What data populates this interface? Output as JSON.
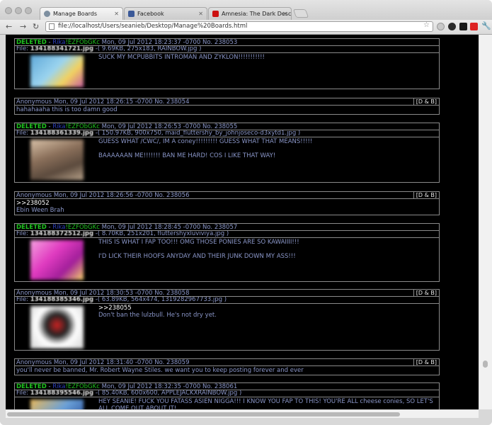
{
  "browser": {
    "tabs": [
      {
        "title": "Manage Boards",
        "favicon_color": "#7d8fa0"
      },
      {
        "title": "Facebook",
        "favicon_color": "#3b5998"
      },
      {
        "title": "Amnesia: The Dark Descent",
        "favicon_color": "#cc1111"
      }
    ],
    "url": "file://localhost/Users/seanieb/Desktop/Manage%20Boards.html"
  },
  "posts": [
    {
      "deleted": "DELETED",
      "sep": "-",
      "name": "Rika",
      "trip": "!EZFObGKc",
      "date": "Mon, 09 Jul 2012 18:23:37 -0700 No. 238053",
      "file_prefix": "File:",
      "file_name": "134188341721.jpg",
      "file_info": "-( 9.69KB, 275x183, RAINBOW.jpg )",
      "lines": [
        "SUCK MY MCPUBBITS INTROMAN AND ZYKLON!!!!!!!!!!!"
      ],
      "thumb_colors": [
        "#5fa8d8",
        "#9bd4ef",
        "#f2d25f",
        "#c75ea0"
      ]
    },
    {
      "name": "Anonymous",
      "date": "Mon, 09 Jul 2012 18:26:15 -0700 No. 238054",
      "db": "[D & B]",
      "lines": [
        "hahahaaha this is too damn good"
      ]
    },
    {
      "deleted": "DELETED",
      "sep": "-",
      "name": "Rika",
      "trip": "!EZFObGKc",
      "date": "Mon, 09 Jul 2012 18:26:53 -0700 No. 238055",
      "file_prefix": "File:",
      "file_name": "134188361339.jpg",
      "file_info": "-( 150.97KB, 900x750, maid_fluttershy_by_johnjoseco-d3xytd1.jpg )",
      "lines": [
        "GUESS WHAT /CWC/, IM A coney!!!!!!!!! GUESS WHAT THAT MEANS!!!!!",
        "BAAAAAAN ME!!!!!!! BAN ME HARD! COS I LIKE THAT WAY!"
      ],
      "thumb_colors": [
        "#8a6f5a",
        "#d9c2a8",
        "#5b4a3d",
        "#b8a28a"
      ]
    },
    {
      "name": "Anonymous",
      "date": "Mon, 09 Jul 2012 18:26:56 -0700 No. 238056",
      "db": "[D & B]",
      "quote": ">>238052",
      "lines": [
        "Ebin Ween Brah"
      ]
    },
    {
      "deleted": "DELETED",
      "sep": "-",
      "name": "Rika",
      "trip": "!EZFObGKc",
      "date": "Mon, 09 Jul 2012 18:28:45 -0700 No. 238057",
      "file_prefix": "File:",
      "file_name": "134188372512.jpg",
      "file_info": "-( 8.70KB, 251x201, fluttershyxluviviya.jpg )",
      "lines": [
        "THIS IS WHAT I FAP TOO!!! OMG THOSE PONIES ARE SO KAWAIIII!!!",
        "I'D LICK THEIR HOOFS ANYDAY AND THEIR JUNK DOWN MY ASS!!!"
      ],
      "thumb_colors": [
        "#e03bc0",
        "#f5a0e0",
        "#a21f9a",
        "#f7d36a"
      ]
    },
    {
      "name": "Anonymous",
      "date": "Mon, 09 Jul 2012 18:30:53 -0700 No. 238058",
      "db": "[D & B]",
      "file_prefix": "File:",
      "file_name": "134188385346.jpg",
      "file_info": "-( 63.89KB, 564x474, 1319282967733.jpg )",
      "quote": ">>238055",
      "lines": [
        "Don't ban the lulzbull. He's not dry yet."
      ],
      "thumb_colors": [
        "#ffffff",
        "#d4d4d4",
        "#cc2222",
        "#222222"
      ]
    },
    {
      "name": "Anonymous",
      "date": "Mon, 09 Jul 2012 18:31:40 -0700 No. 238059",
      "db": "[D & B]",
      "lines": [
        "you'll never be banned, Mr. Robert Wayne Stiles. we want you to keep posting forever and ever"
      ]
    },
    {
      "deleted": "DELETED",
      "sep": "-",
      "name": "Rika",
      "trip": "!EZFObGKc",
      "date": "Mon, 09 Jul 2012 18:32:35 -0700 No. 238061",
      "file_prefix": "File:",
      "file_name": "134188395546.jpg",
      "file_info": "-( 85.40KB, 600x600, APPLEJACKXRAINBOW.jpg )",
      "lines": [
        "HEY SEANIE! FUCK YOU FATASS ASIEN NIGGA!!! I KNOW YOU FAP TO THIS! YOU'RE ALL cheese conies, SO LET'S ALL COME OUT ABOUT IT!"
      ],
      "thumb_colors": [
        "#6aa0d8",
        "#e8b85a",
        "#3f6bb0",
        "#f0d890"
      ]
    }
  ]
}
